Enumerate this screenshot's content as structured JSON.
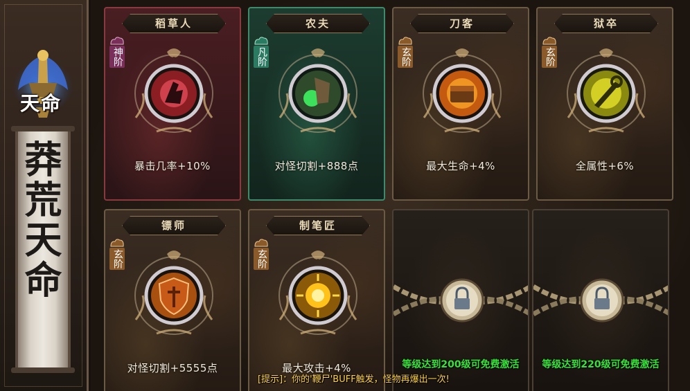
{
  "banner": {
    "emblem_title": "天命",
    "scroll_text": "莽荒天命"
  },
  "cards": [
    {
      "title": "稻草人",
      "tier": "神阶",
      "stat": "暴击几率+10%",
      "icon": "blood-fist-icon",
      "accent": "#c0303a",
      "locked": false
    },
    {
      "title": "农夫",
      "tier": "凡阶",
      "stat": "对怪切割+888点",
      "icon": "green-gauntlet-icon",
      "accent": "#3ce05a",
      "locked": false
    },
    {
      "title": "刀客",
      "tier": "玄阶",
      "stat": "最大生命+4%",
      "icon": "fire-chest-icon",
      "accent": "#f08a1c",
      "locked": false
    },
    {
      "title": "狱卒",
      "tier": "玄阶",
      "stat": "全属性+6%",
      "icon": "yellow-wrench-icon",
      "accent": "#e6e02a",
      "locked": false
    },
    {
      "title": "镖师",
      "tier": "玄阶",
      "stat": "对怪切割+5555点",
      "icon": "shield-icon",
      "accent": "#e07a1a",
      "locked": false
    },
    {
      "title": "制笔匠",
      "tier": "玄阶",
      "stat": "最大攻击+4%",
      "icon": "golden-sun-icon",
      "accent": "#ffc21a",
      "locked": false
    },
    {
      "title": "",
      "tier": "",
      "stat": "等级达到200级可免费激活",
      "icon": "padlock-icon",
      "accent": "#38e23a",
      "locked": true
    },
    {
      "title": "",
      "tier": "",
      "stat": "等级达到220级可免费激活",
      "icon": "padlock-icon",
      "accent": "#38e23a",
      "locked": true
    }
  ],
  "tip": "[提示]：你的'鞭尸'BUFF触发，怪物再爆出一次!"
}
